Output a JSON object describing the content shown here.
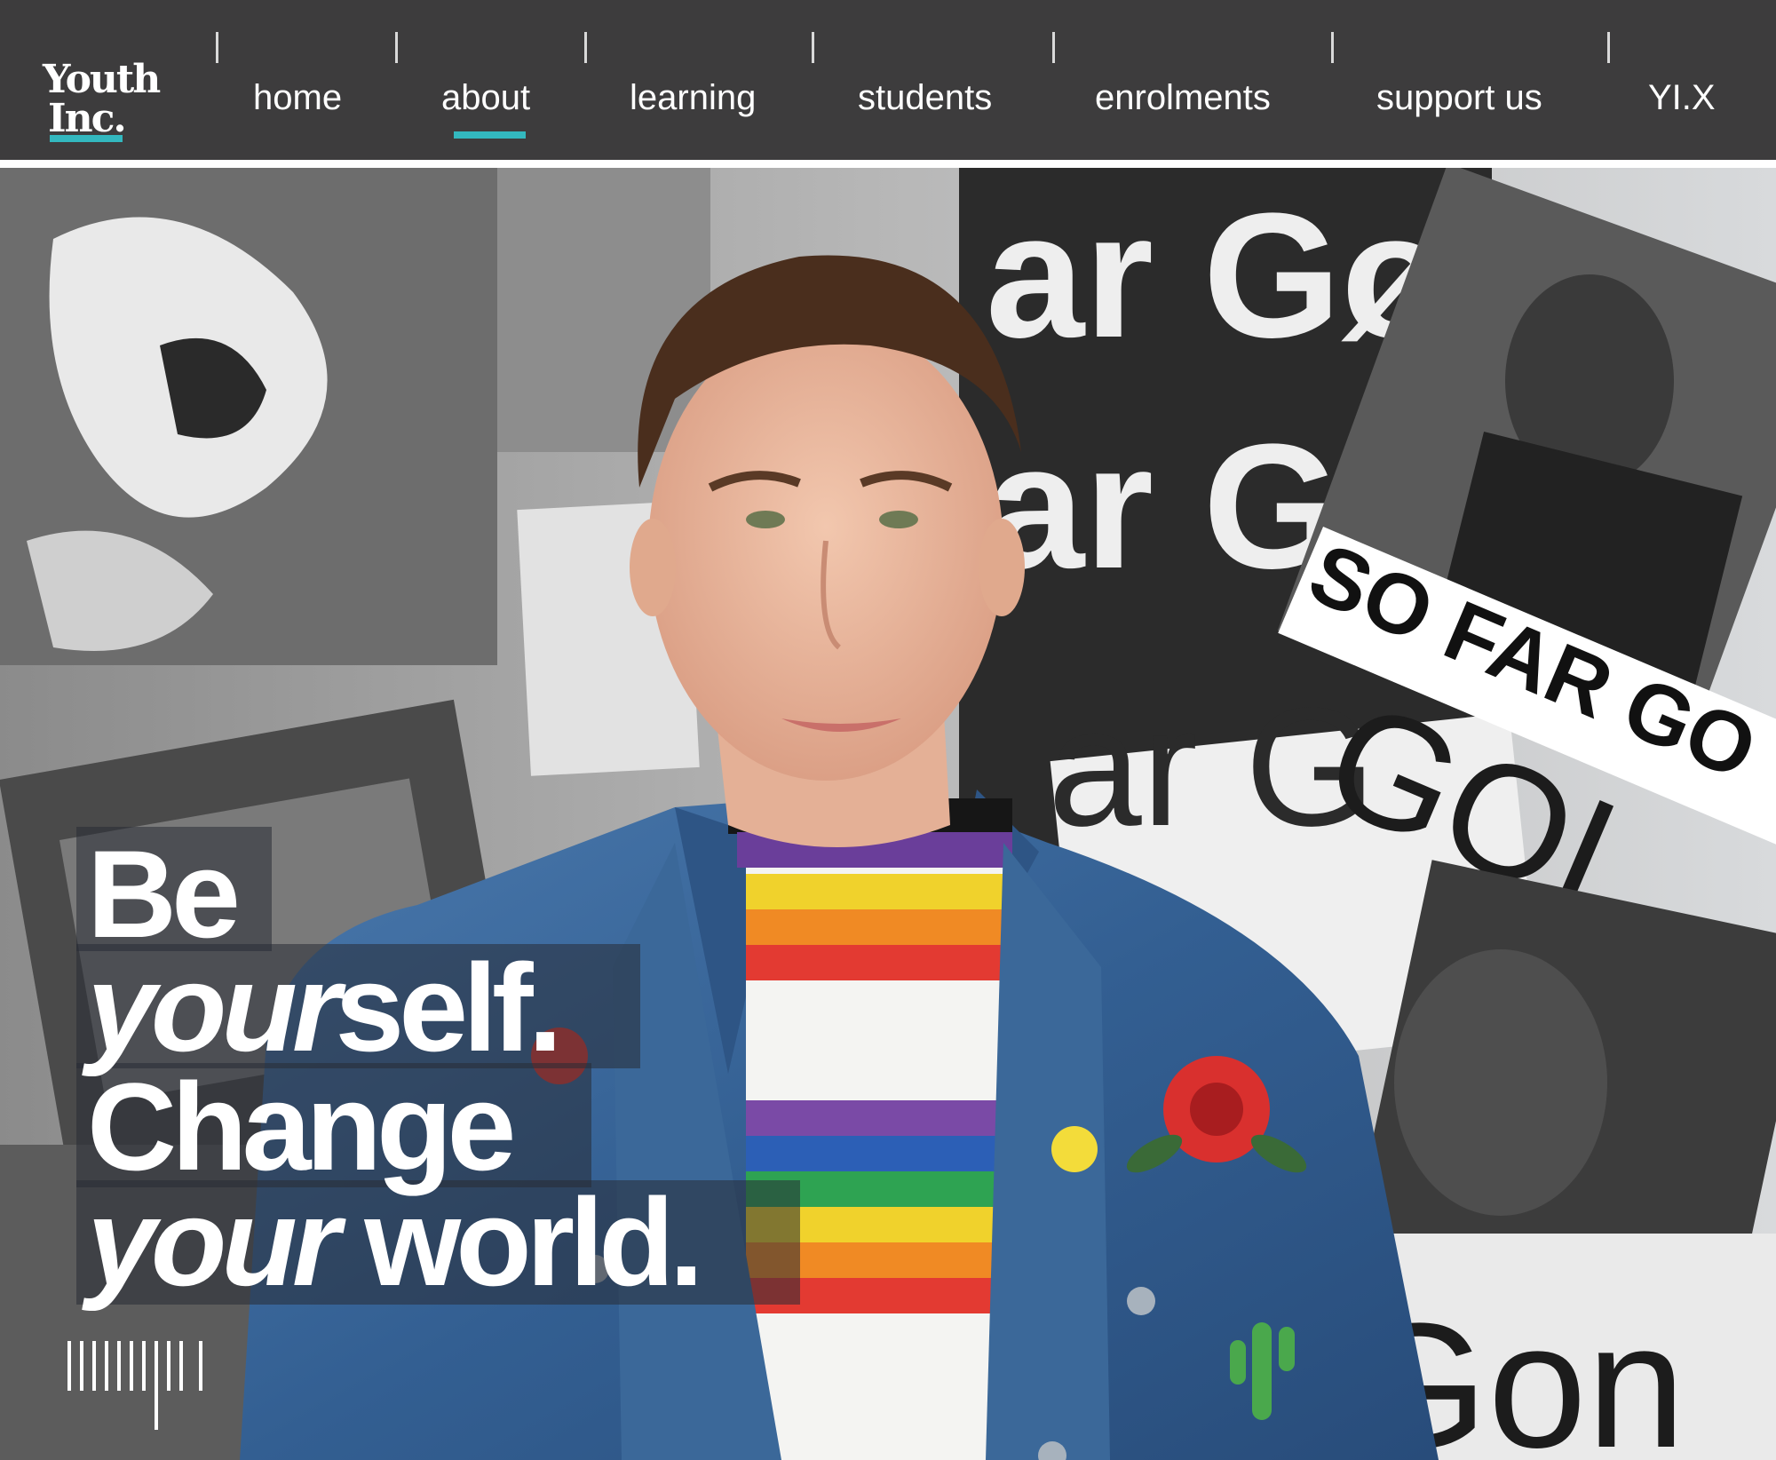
{
  "logo": {
    "line1": "Youth",
    "line2": "Inc."
  },
  "nav": {
    "items": [
      {
        "label": "home",
        "active": false
      },
      {
        "label": "about",
        "active": true
      },
      {
        "label": "learning",
        "active": false
      },
      {
        "label": "students",
        "active": false
      },
      {
        "label": "enrolments",
        "active": false
      },
      {
        "label": "support us",
        "active": false
      },
      {
        "label": "YI.X",
        "active": false
      }
    ]
  },
  "hero": {
    "headline": {
      "line1": "Be",
      "line2_italic": "your",
      "line2_rest": "self.",
      "line3": "Change",
      "line4_italic": "your",
      "line4_rest": "world."
    },
    "background_posters": {
      "big_text_1": "ar Gø",
      "big_text_2": "ar G",
      "big_text_3": "ar G",
      "banner": "SO FAR GO",
      "big_text_4": "Gon",
      "big_text_5": "GOL"
    }
  },
  "colors": {
    "nav_bg": "#3d3c3d",
    "accent": "#33b8bf",
    "text_on_dark": "#ffffff"
  }
}
